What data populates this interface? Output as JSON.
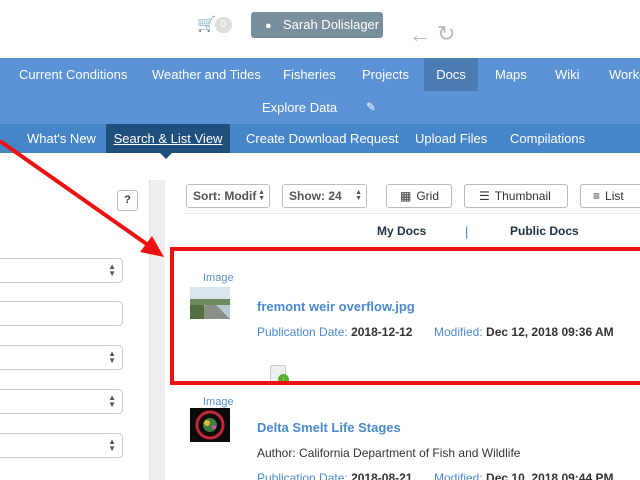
{
  "header": {
    "cart_count": "0",
    "user_name": "Sarah Dolislager"
  },
  "main_nav": {
    "items": [
      {
        "label": "Current Conditions"
      },
      {
        "label": "Weather and Tides"
      },
      {
        "label": "Fisheries"
      },
      {
        "label": "Projects"
      },
      {
        "label": "Docs"
      },
      {
        "label": "Maps"
      },
      {
        "label": "Wiki"
      },
      {
        "label": "Workg"
      }
    ],
    "row2_label": "Explore Data"
  },
  "sub_nav": {
    "items": [
      {
        "label": "What's New"
      },
      {
        "label": "Search & List View"
      },
      {
        "label": "Create Download Request"
      },
      {
        "label": "Upload Files"
      },
      {
        "label": "Compilations"
      }
    ]
  },
  "left_panel": {
    "help_label": "?"
  },
  "toolbar": {
    "sort_label": "Sort: Modif",
    "show_label": "Show: 24",
    "grid_label": "Grid",
    "thumbnail_label": "Thumbnail",
    "list_label": "List"
  },
  "tabs": {
    "my_docs": "My Docs",
    "separator": "|",
    "public_docs": "Public Docs"
  },
  "results": [
    {
      "type": "Image",
      "title": "fremont weir overflow.jpg",
      "pub_label": "Publication Date:",
      "pub_date": "2018-12-12",
      "mod_label": "Modified:",
      "modified": "Dec 12, 2018 09:36 AM"
    },
    {
      "type": "Image",
      "title": "Delta Smelt Life Stages",
      "author": "Author: California Department of Fish and Wildlife",
      "pub_label": "Publication Date:",
      "pub_date": "2018-08-21",
      "mod_label": "Modified:",
      "modified": "Dec 10, 2018 09:44 PM"
    }
  ],
  "icons": {
    "cart": "shopping-basket-icon",
    "user": "user-icon",
    "back": "arrow-left-icon",
    "refresh": "refresh-icon",
    "edit": "edit-icon",
    "grid": "grid-icon",
    "thumbnail": "thumbnail-list-icon",
    "list": "list-icon",
    "download": "download-icon"
  },
  "colors": {
    "nav_blue": "#5b93d6",
    "subnav_blue": "#4686c8",
    "active_dark": "#1f4f7c",
    "link_blue": "#4a8ad0",
    "highlight_red": "#ee1111"
  }
}
